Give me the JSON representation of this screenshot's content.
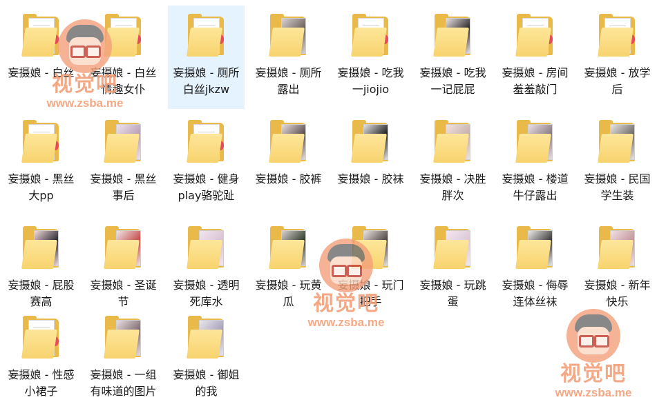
{
  "folders": [
    {
      "name": "妄摄娘 - 白丝",
      "thumb": "papers",
      "colors": [
        "#f4f4f4",
        "#e6e6e6"
      ]
    },
    {
      "name": "妄摄娘 - 白丝情趣女仆",
      "thumb": "papers",
      "colors": [
        "#f4f4f4",
        "#e6e6e6"
      ]
    },
    {
      "name": "妄摄娘 - 厕所白丝jkzw",
      "thumb": "papers",
      "colors": [
        "#f4f4f4",
        "#e6e6e6"
      ],
      "selected": true
    },
    {
      "name": "妄摄娘 - 厕所露出",
      "thumb": "photo",
      "colors": [
        "#d9d2cf",
        "#6e625d"
      ]
    },
    {
      "name": "妄摄娘 - 吃我一jiojio",
      "thumb": "papers",
      "colors": [
        "#f4f4f4",
        "#e6e6e6"
      ]
    },
    {
      "name": "妄摄娘 - 吃我一记屁屁",
      "thumb": "photo",
      "colors": [
        "#e9e2e2",
        "#2e2a2c"
      ]
    },
    {
      "name": "妄摄娘 - 房间羞羞敲门",
      "thumb": "papers",
      "colors": [
        "#f4f4f4",
        "#e6e6e6"
      ]
    },
    {
      "name": "妄摄娘 - 放学后",
      "thumb": "papers",
      "colors": [
        "#f4f4f4",
        "#e6e6e6"
      ]
    },
    {
      "name": "妄摄娘 - 黑丝大pp",
      "thumb": "papers",
      "colors": [
        "#f4f4f4",
        "#e6e6e6"
      ]
    },
    {
      "name": "妄摄娘 - 黑丝事后",
      "thumb": "photo",
      "colors": [
        "#efe3ea",
        "#b79fb6"
      ]
    },
    {
      "name": "妄摄娘 - 健身play骆驼趾",
      "thumb": "papers",
      "colors": [
        "#f4f4f4",
        "#e6e6e6"
      ]
    },
    {
      "name": "妄摄娘 - 胶裤",
      "thumb": "photo",
      "colors": [
        "#e8dede",
        "#5a4c4c"
      ]
    },
    {
      "name": "妄摄娘 - 胶袜",
      "thumb": "photo",
      "colors": [
        "#e2e2e2",
        "#1f1f1f"
      ]
    },
    {
      "name": "妄摄娘 - 决胜胖次",
      "thumb": "photo",
      "colors": [
        "#f1e2df",
        "#c7b0aa"
      ]
    },
    {
      "name": "妄摄娘 - 楼道牛仔露出",
      "thumb": "photo",
      "colors": [
        "#eadfe3",
        "#897c83"
      ]
    },
    {
      "name": "妄摄娘 - 民国学生装",
      "thumb": "photo",
      "colors": [
        "#e7e4e2",
        "#6d6a68"
      ]
    },
    {
      "name": "妄摄娘 - 屁股赛高",
      "thumb": "photo",
      "colors": [
        "#f3d9dc",
        "#2d2c33"
      ]
    },
    {
      "name": "妄摄娘 - 圣诞节",
      "thumb": "photo",
      "colors": [
        "#f0e4e4",
        "#c64a4a"
      ]
    },
    {
      "name": "妄摄娘 - 透明死库水",
      "thumb": "photo",
      "colors": [
        "#f1e6ee",
        "#d9c2d2"
      ]
    },
    {
      "name": "妄摄娘 - 玩黄瓜",
      "thumb": "photo",
      "colors": [
        "#d9d1cf",
        "#2e3c2a"
      ]
    },
    {
      "name": "妄摄娘 - 玩门把手",
      "thumb": "photo",
      "colors": [
        "#e9e3de",
        "#4d4440"
      ]
    },
    {
      "name": "妄摄娘 - 玩跳蛋",
      "thumb": "photo",
      "colors": [
        "#f2e8ef",
        "#dcc7d8"
      ]
    },
    {
      "name": "妄摄娘 - 侮辱连体丝袜",
      "thumb": "photo",
      "colors": [
        "#ebe7e7",
        "#3d3b3b"
      ]
    },
    {
      "name": "妄摄娘 - 新年快乐",
      "thumb": "photo",
      "colors": [
        "#f1e0e3",
        "#c3959b"
      ]
    },
    {
      "name": "妄摄娘 - 性感小裙子",
      "thumb": "papers",
      "colors": [
        "#f4f4f4",
        "#e6e6e6"
      ]
    },
    {
      "name": "妄摄娘 - 一组有味道的图片",
      "thumb": "photo",
      "colors": [
        "#eadde0",
        "#7f6d72"
      ]
    },
    {
      "name": "妄摄娘 - 御姐的我",
      "thumb": "photo",
      "colors": [
        "#e9e6ee",
        "#a7a1b8"
      ]
    }
  ],
  "watermarks": [
    {
      "title": "视觉吧",
      "url": "www.zsba.me"
    },
    {
      "title": "视觉吧",
      "url": "www.zsba.me"
    },
    {
      "title": "视觉吧",
      "url": "www.zsba.me"
    }
  ],
  "colors": {
    "selection": "#e5f3ff",
    "folder_back": "#e9b94a",
    "folder_front": "#f8d36e",
    "watermark": "#f3a07a"
  }
}
